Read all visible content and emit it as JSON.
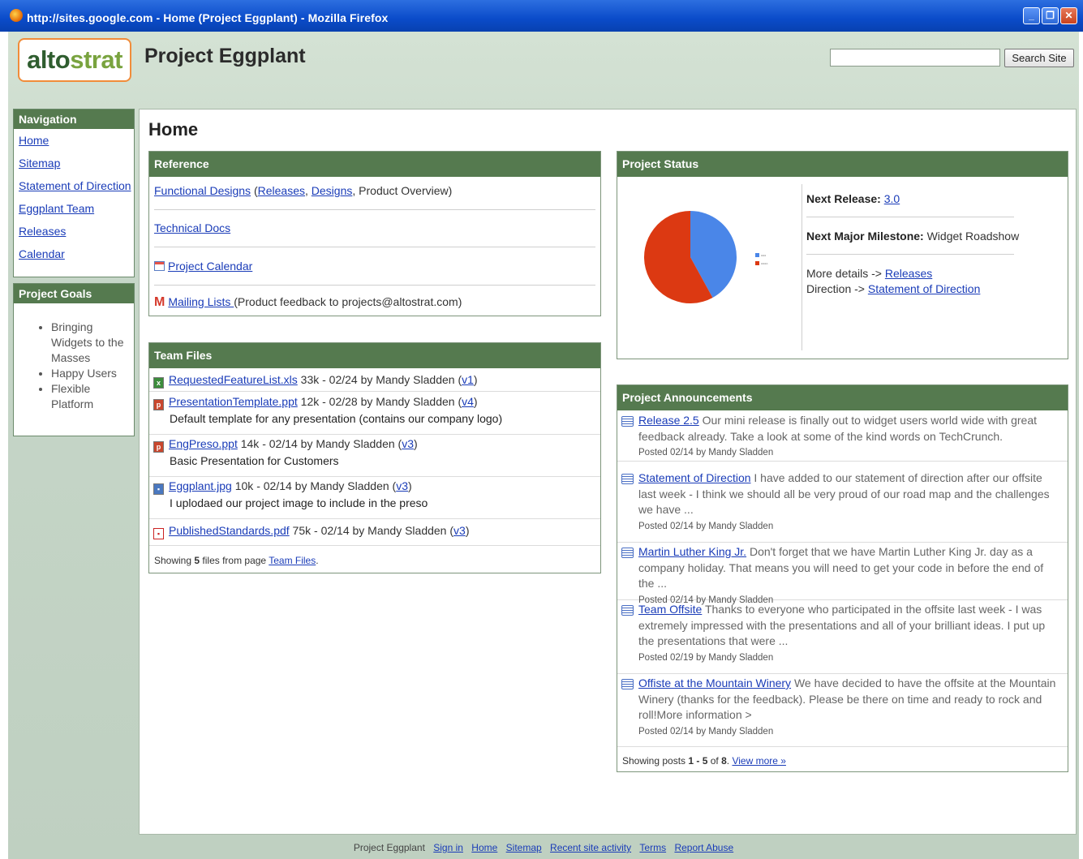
{
  "window": {
    "title": "http://sites.google.com - Home (Project Eggplant) - Mozilla Firefox"
  },
  "header": {
    "logo_part1": "alto",
    "logo_part2": "strat",
    "site_title": "Project Eggplant",
    "search_value": "",
    "search_button": "Search Site"
  },
  "sidebar": {
    "nav_title": "Navigation",
    "nav_items": [
      "Home",
      "Sitemap",
      "Statement of Direction",
      "Eggplant Team",
      "Releases",
      "Calendar"
    ],
    "goals_title": "Project Goals",
    "goals": [
      "Bringing Widgets to the Masses",
      "Happy Users",
      "Flexible Platform"
    ]
  },
  "main": {
    "page_title": "Home",
    "reference": {
      "title": "Reference",
      "functional_designs": "Functional Designs",
      "open_paren": " (",
      "releases": "Releases",
      "comma": ", ",
      "designs": "Designs",
      "product_overview": ", Product Overview)",
      "technical_docs": "Technical Docs",
      "project_calendar": "Project Calendar",
      "mailing_lists": "Mailing Lists ",
      "mailing_note": " (Product feedback to projects@altostrat.com)"
    },
    "team_files": {
      "title": "Team Files",
      "files": [
        {
          "name": "RequestedFeatureList.xls",
          "meta": " 33k - 02/24 by Mandy Sladden (",
          "version": "v1",
          "close": ")",
          "desc": "",
          "type": "xls"
        },
        {
          "name": "PresentationTemplate.ppt",
          "meta": " 12k - 02/28 by Mandy Sladden (",
          "version": "v4",
          "close": ")",
          "desc": "Default template for any presentation (contains our company logo)",
          "type": "ppt"
        },
        {
          "name": "EngPreso.ppt",
          "meta": " 14k - 02/14 by Mandy Sladden (",
          "version": "v3",
          "close": ")",
          "desc": "Basic Presentation for Customers",
          "type": "ppt"
        },
        {
          "name": "Eggplant.jpg",
          "meta": " 10k - 02/14 by Mandy Sladden (",
          "version": "v3",
          "close": ")",
          "desc": "I uplodaed our project image to include in the preso",
          "type": "jpg"
        },
        {
          "name": "PublishedStandards.pdf",
          "meta": " 75k - 02/14 by Mandy Sladden (",
          "version": "v3",
          "close": ")",
          "desc": "",
          "type": "pdf"
        }
      ],
      "footer_prefix": "Showing ",
      "footer_count": "5",
      "footer_mid": " files from page ",
      "footer_link": "Team Files",
      "footer_end": "."
    },
    "status": {
      "title": "Project Status",
      "pie": {
        "blue_fraction": 0.42,
        "red_fraction": 0.58,
        "blue_color": "#4a86e8",
        "red_color": "#dc3912"
      },
      "next_release_label": "Next Release:",
      "next_release_value": "3.0",
      "milestone_label": "Next Major Milestone:",
      "milestone_value": " Widget Roadshow",
      "more_details": "More details -> ",
      "releases_link": "Releases",
      "direction": "Direction -> ",
      "direction_link": "Statement of Direction"
    },
    "announcements": {
      "title": "Project Announcements",
      "items": [
        {
          "title": "Release 2.5",
          "body": " Our mini release is finally out to widget users world wide with great feedback already. Take a look at some of the kind words on TechCrunch.",
          "posted": "Posted 02/14 by Mandy Sladden"
        },
        {
          "title": "Statement of Direction",
          "body": " I have added to our statement of direction after our offsite last week - I think we should all be very proud of our road map and the challenges we have ...",
          "posted": "Posted 02/14 by Mandy Sladden"
        },
        {
          "title": "Martin Luther King Jr.",
          "body": " Don't forget that we have Martin Luther King Jr. day as a company holiday. That means you will need to get your code in before the end of the ...",
          "posted": "Posted 02/14 by Mandy Sladden"
        },
        {
          "title": "Team Offsite",
          "body": " Thanks to everyone who participated in the offsite last week - I was extremely impressed with the presentations and all of your brilliant ideas. I put up the presentations that were ...",
          "posted": "Posted 02/19 by Mandy Sladden"
        },
        {
          "title": "Offiste at the Mountain Winery",
          "body": " We have decided to have the offsite at the Mountain Winery (thanks for the feedback). Please be there on time and ready to rock and roll!More information >",
          "posted": "Posted 02/14 by Mandy Sladden"
        }
      ],
      "footer_prefix": "Showing posts ",
      "footer_range": "1 - 5",
      "footer_of": " of ",
      "footer_total": "8",
      "footer_dot": ". ",
      "view_more": "View more »"
    }
  },
  "footer": {
    "site": "Project Eggplant",
    "links": [
      "Sign in",
      "Home",
      "Sitemap",
      "Recent site activity",
      "Terms",
      "Report Abuse"
    ]
  }
}
